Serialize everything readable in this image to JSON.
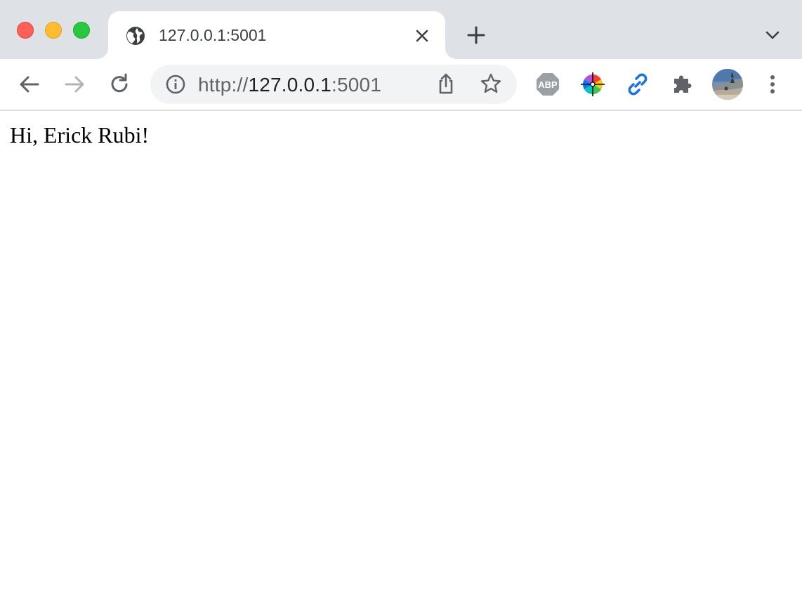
{
  "window": {
    "traffic_lights": {
      "close_color": "#fe5f57",
      "minimize_color": "#febc2e",
      "maximize_color": "#28c840"
    }
  },
  "tab": {
    "title": "127.0.0.1:5001",
    "favicon": "globe-icon",
    "close_icon": "close-icon"
  },
  "tabstrip": {
    "new_tab_icon": "plus-icon",
    "tab_search_icon": "chevron-down-icon"
  },
  "toolbar": {
    "back_icon": "arrow-left-icon",
    "forward_icon": "arrow-right-icon",
    "reload_icon": "reload-icon",
    "omnibox": {
      "info_icon": "info-icon",
      "url_scheme": "http://",
      "url_host": "127.0.0.1",
      "url_port": ":5001",
      "share_icon": "share-icon",
      "bookmark_icon": "star-icon"
    },
    "extensions": [
      {
        "name": "adblock-plus-icon",
        "label": "ABP"
      },
      {
        "name": "color-picker-icon"
      },
      {
        "name": "link-icon"
      },
      {
        "name": "puzzle-icon"
      }
    ],
    "profile_avatar": "avatar",
    "menu_icon": "kebab-menu-icon"
  },
  "page": {
    "greeting": "Hi, Erick Rubi!"
  },
  "colors": {
    "tabstrip_bg": "#dee1e6",
    "omnibox_bg": "#f1f3f4",
    "icon_gray": "#5f6368",
    "link_blue": "#4285f4"
  }
}
